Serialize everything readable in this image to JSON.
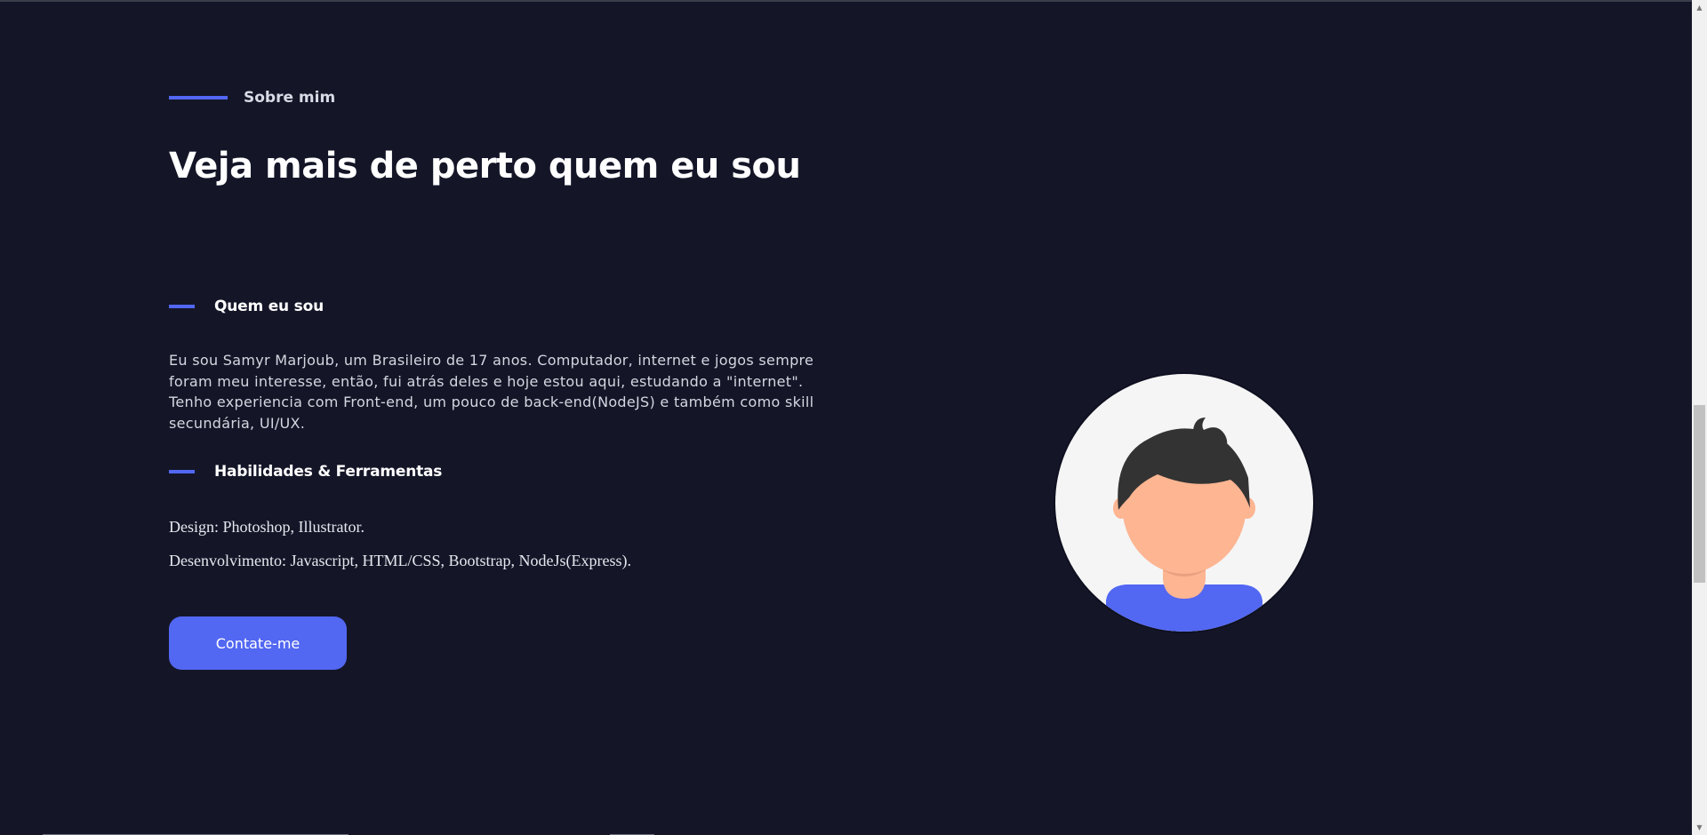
{
  "about": {
    "eyebrow": "Sobre mim",
    "heading": "Veja mais de perto quem eu sou",
    "who_title": "Quem eu sou",
    "bio": "Eu sou Samyr Marjoub, um Brasileiro de 17 anos. Computador, internet e jogos sempre foram meu interesse, então, fui atrás deles e hoje estou aqui, estudando a \"internet\". Tenho experiencia com Front-end, um pouco de back-end(NodeJS) e também como skill secundária, UI/UX.",
    "skills_title": "Habilidades & Ferramentas",
    "skill_design": "Design: Photoshop, Illustrator.",
    "skill_dev": "Desenvolvimento: Javascript, HTML/CSS, Bootstrap, NodeJs(Express).",
    "cta_label": "Contate-me"
  },
  "avatar": {
    "icon": "user-avatar-illustration"
  },
  "colors": {
    "background": "#141628",
    "accent": "#5267f2",
    "text": "#ffffff",
    "avatar_bg": "#f5f5f5",
    "skin": "#fdb592",
    "hair": "#333333"
  }
}
